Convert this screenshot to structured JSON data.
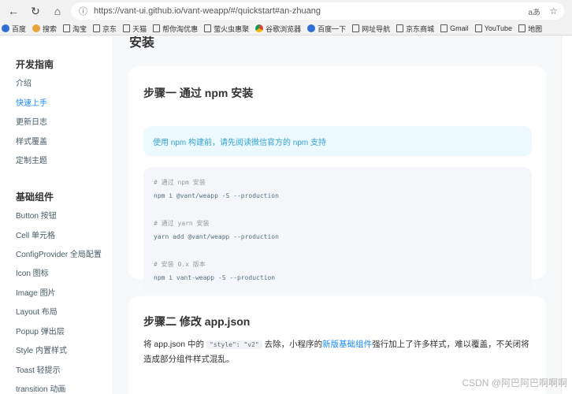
{
  "browser": {
    "url": "https://vant-ui.github.io/vant-weapp/#/quickstart#an-zhuang",
    "reader_label": "aあ",
    "bookmarks": [
      "百度",
      "搜索",
      "淘宝",
      "京东",
      "天猫",
      "帮你淘优惠",
      "萤火虫惠聚",
      "谷歌浏览器",
      "百度一下",
      "网址导航",
      "京东商城",
      "Gmail",
      "YouTube",
      "地图"
    ]
  },
  "sidebar": {
    "group1_title": "开发指南",
    "group1_items": [
      "介绍",
      "快速上手",
      "更新日志",
      "样式覆盖",
      "定制主题"
    ],
    "active_item": "快速上手",
    "group2_title": "基础组件",
    "group2_items": [
      "Button 按钮",
      "Cell 单元格",
      "ConfigProvider 全局配置",
      "Icon 图标",
      "Image 图片",
      "Layout 布局",
      "Popup 弹出层",
      "Style 内置样式",
      "Toast 轻提示",
      "transition 动画"
    ]
  },
  "main": {
    "section_fragment": "安装",
    "step1": {
      "title": "步骤一 通过 npm 安装",
      "tip": "使用 npm 构建前，请先阅读微信官方的 npm 支持",
      "code": {
        "c1": "# 通过 npm 安装",
        "l1": "npm i @vant/weapp -S --production",
        "c2": "# 通过 yarn 安装",
        "l2": "yarn add @vant/weapp --production",
        "c3": "# 安装 0.x 版本",
        "l3": "npm i vant-weapp -S --production"
      }
    },
    "step2": {
      "title": "步骤二 修改 app.json",
      "text_before": "将 app.json 中的",
      "inline_code": "\"style\": \"v2\"",
      "text_middle": "去除，小程序的",
      "link_text": "新版基础组件",
      "text_after": "强行加上了许多样式，难以覆盖，不关闭将造成部分组件样式混乱。"
    }
  },
  "watermark": "CSDN @阿巴阿巴啊啊啊",
  "colors": {
    "accent": "#1989fa",
    "tip_bg": "#ecf9ff",
    "tip_text": "#34a2d1",
    "code_bg": "#f4f6f9",
    "page_bg": "#f7f8fa"
  }
}
